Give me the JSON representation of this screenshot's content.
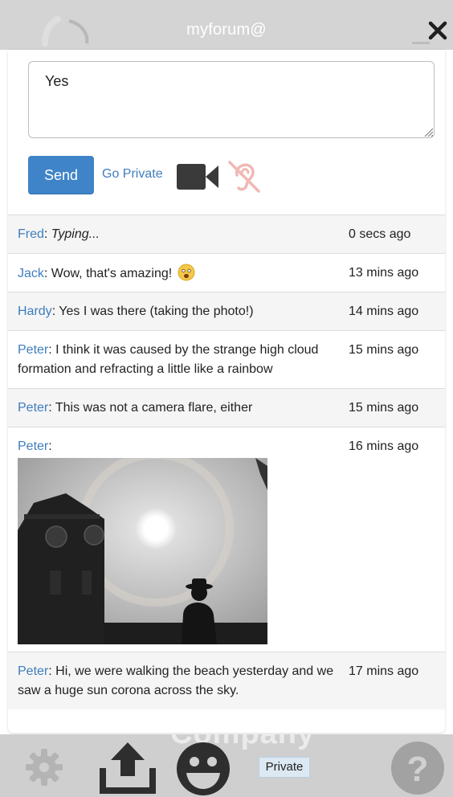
{
  "header": {
    "title": "myforum@",
    "close_icon": "close-icon"
  },
  "composer": {
    "value": "Yes",
    "send_label": "Send",
    "go_private_label": "Go Private",
    "video_icon": "video-camera-icon",
    "audio_icon": "ear-muted-icon"
  },
  "messages": [
    {
      "author": "Fred",
      "text": "Typing...",
      "time": "0 secs ago",
      "typing": true
    },
    {
      "author": "Jack",
      "text": "Wow, that's amazing!",
      "time": "13 mins ago",
      "emoji": "amazed-face-emoji"
    },
    {
      "author": "Hardy",
      "text": "Yes I was there (taking the photo!)",
      "time": "14 mins ago"
    },
    {
      "author": "Peter",
      "text": "I think it was caused by the strange high cloud formation and refracting a little like a rainbow",
      "time": "15 mins ago"
    },
    {
      "author": "Peter",
      "text": "This was not a camera flare, either",
      "time": "15 mins ago"
    },
    {
      "author": "Peter",
      "text": "",
      "time": "16 mins ago",
      "image": "sun-halo-photo"
    },
    {
      "author": "Peter",
      "text": "Hi, we were walking the beach yesterday and we saw a huge sun corona across the sky.",
      "time": "17 mins ago"
    }
  ],
  "footer": {
    "background_text": "Company",
    "private_label": "Private",
    "icons": [
      "settings-gear-icon",
      "upload-icon",
      "smiley-icon",
      "help-icon"
    ]
  },
  "colors": {
    "accent": "#3f84c8",
    "link": "#3f7dbd",
    "bar": "#d4d4d4",
    "icon_dark": "#3a3a3a",
    "ear_muted": "#f0b8b4"
  }
}
